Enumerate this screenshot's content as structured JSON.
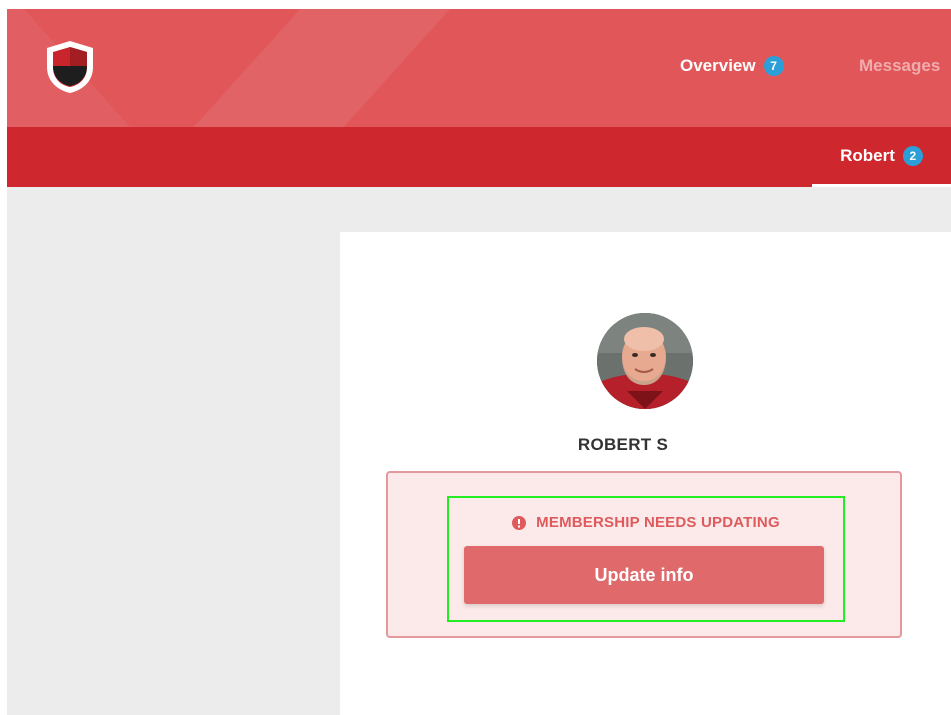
{
  "header": {
    "logo_name": "shield-logo",
    "nav": [
      {
        "label": "Overview",
        "badge": "7"
      },
      {
        "label": "Messages"
      }
    ]
  },
  "subheader": {
    "user_tab": {
      "label": "Robert",
      "badge": "2"
    }
  },
  "profile": {
    "name": "ROBERT S"
  },
  "alert": {
    "icon": "info-icon",
    "message": "MEMBERSHIP NEEDS UPDATING",
    "button_label": "Update info"
  },
  "colors": {
    "header_bg": "#e05659",
    "subheader_bg": "#cf272e",
    "badge": "#2d9fd8",
    "alert_text": "#de5a5c",
    "alert_border": "#e49a9c",
    "button": "#e0696c",
    "highlight": "#22ee22"
  }
}
